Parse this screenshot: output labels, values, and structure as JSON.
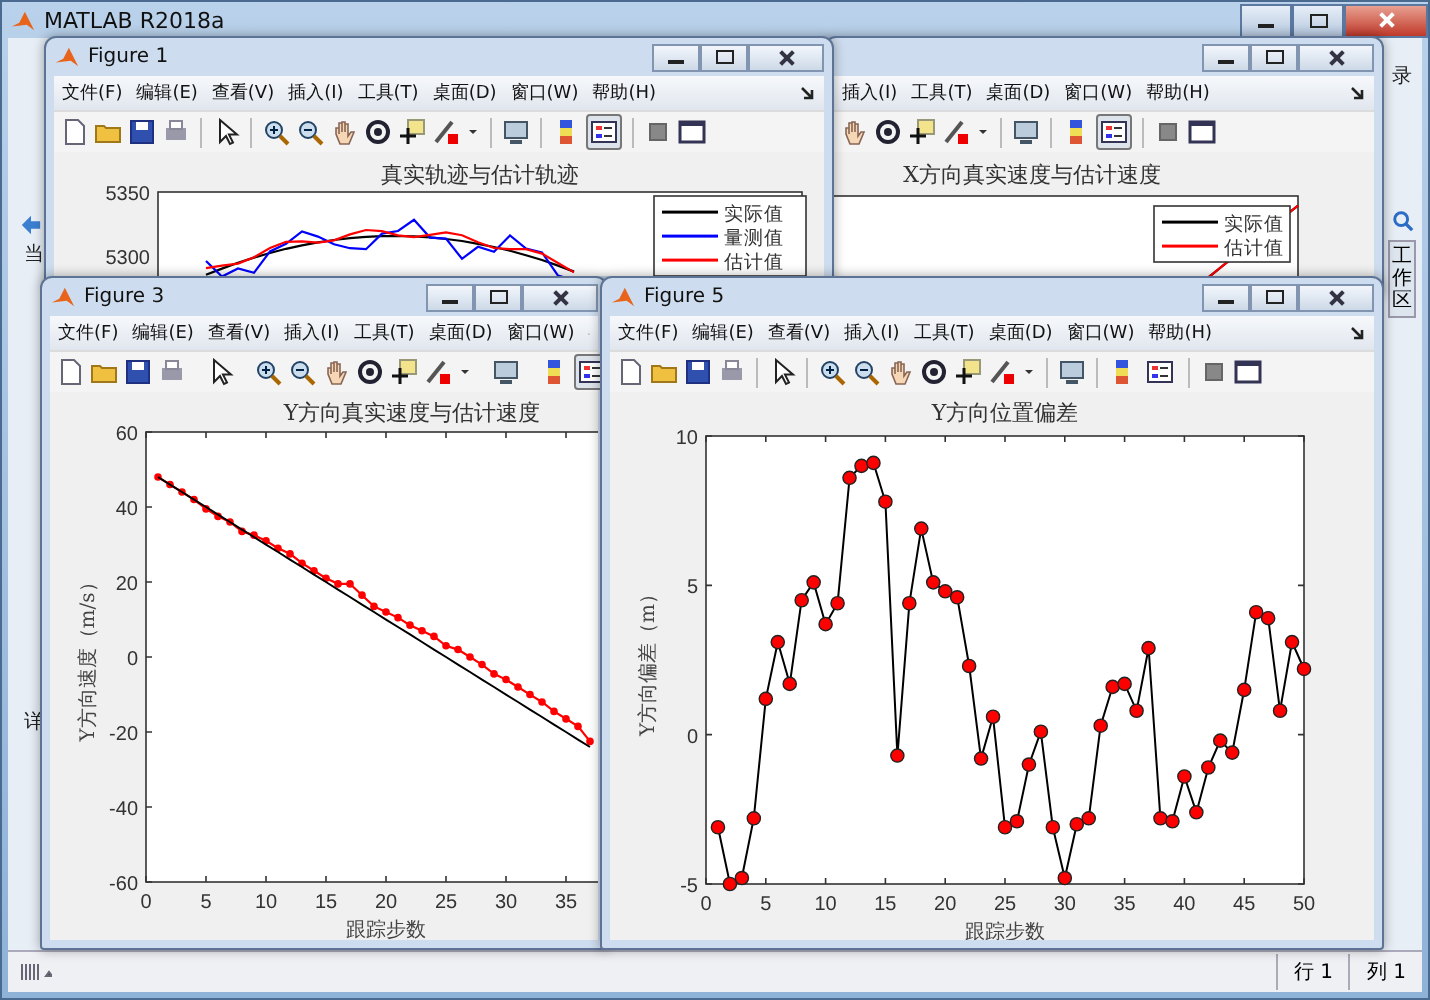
{
  "app": {
    "title": "MATLAB R2018a",
    "left_labels": [
      "当",
      "详"
    ],
    "right_label": "录",
    "workspace_tab": "工作区",
    "status_row": "行 1",
    "status_col": "列 1"
  },
  "figures": [
    {
      "title": "Figure 1",
      "kind": "legend_plot",
      "menus": [
        "文件(F)",
        "编辑(E)",
        "查看(V)",
        "插入(I)",
        "工具(T)",
        "桌面(D)",
        "窗口(W)",
        "帮助(H)"
      ],
      "legend_button_pressed": true,
      "plot": {
        "title": "真实轨迹与估计轨迹",
        "ytick_labels": [
          "5350",
          "5300"
        ],
        "legend": [
          {
            "label": "实际值",
            "color": "#000000"
          },
          {
            "label": "量测值",
            "color": "#0000ff"
          },
          {
            "label": "估计值",
            "color": "#ff0000"
          }
        ]
      }
    },
    {
      "kind": "legend_plot",
      "menus": [
        "插入(I)",
        "工具(T)",
        "桌面(D)",
        "窗口(W)",
        "帮助(H)"
      ],
      "legend_button_pressed": true,
      "plot": {
        "title": "X方向真实速度与估计速度",
        "legend": [
          {
            "label": "实际值",
            "color": "#000000"
          },
          {
            "label": "估计值",
            "color": "#ff0000"
          }
        ]
      }
    },
    {
      "title": "Figure 3",
      "kind": "chart",
      "menus": [
        "文件(F)",
        "编辑(E)",
        "查看(V)",
        "插入(I)",
        "工具(T)",
        "桌面(D)",
        "窗口(W)"
      ],
      "legend_button_pressed": true,
      "chart_data": {
        "type": "line",
        "title": "Y方向真实速度与估计速度",
        "xlabel": "跟踪步数",
        "ylabel": "Y方向速度（m/s）",
        "x": [
          1,
          2,
          3,
          4,
          5,
          6,
          7,
          8,
          9,
          10,
          11,
          12,
          13,
          14,
          15,
          16,
          17,
          18,
          19,
          20,
          21,
          22,
          23,
          24,
          25,
          26,
          27,
          28,
          29,
          30,
          31,
          32,
          33,
          34,
          35,
          36,
          37
        ],
        "xlim": [
          0,
          50
        ],
        "ylim": [
          -60,
          60
        ],
        "xticks": [
          0,
          5,
          10,
          15,
          20,
          25,
          30,
          35
        ],
        "yticks": [
          -60,
          -40,
          -20,
          0,
          20,
          40,
          60
        ],
        "series": [
          {
            "color": "#000000",
            "values": [
              48,
              46,
              44,
              42,
              40,
              38,
              36,
              34,
              32,
              30,
              28,
              26,
              24,
              22,
              20,
              18,
              16,
              14,
              12,
              10,
              8,
              6,
              4,
              2,
              0,
              -2,
              -4,
              -6,
              -8,
              -10,
              -12,
              -14,
              -16,
              -18,
              -20,
              -22,
              -24
            ]
          },
          {
            "color": "#ff0000",
            "marker": "circle",
            "values": [
              48,
              46,
              44,
              42,
              39.5,
              37.5,
              36,
              33.5,
              32.5,
              31,
              29,
              27.5,
              25,
              23,
              21,
              19.5,
              19.5,
              16.5,
              13.5,
              12,
              10.5,
              8.5,
              7,
              5.5,
              3,
              2,
              0,
              -2,
              -4.5,
              -6,
              -8,
              -10,
              -12,
              -14.5,
              -16.5,
              -18.5,
              -22.5
            ]
          }
        ]
      }
    },
    {
      "title": "Figure 5",
      "kind": "chart",
      "menus": [
        "文件(F)",
        "编辑(E)",
        "查看(V)",
        "插入(I)",
        "工具(T)",
        "桌面(D)",
        "窗口(W)",
        "帮助(H)"
      ],
      "legend_button_pressed": false,
      "chart_data": {
        "type": "line",
        "title": "Y方向位置偏差",
        "xlabel": "跟踪步数",
        "ylabel": "Y方向偏差（m）",
        "x": [
          1,
          2,
          3,
          4,
          5,
          6,
          7,
          8,
          9,
          10,
          11,
          12,
          13,
          14,
          15,
          16,
          17,
          18,
          19,
          20,
          21,
          22,
          23,
          24,
          25,
          26,
          27,
          28,
          29,
          30,
          31,
          32,
          33,
          34,
          35,
          36,
          37,
          38,
          39,
          40,
          41,
          42,
          43,
          44,
          45,
          46,
          47,
          48,
          49,
          50
        ],
        "xlim": [
          0,
          50
        ],
        "ylim": [
          -5,
          10
        ],
        "xticks": [
          0,
          5,
          10,
          15,
          20,
          25,
          30,
          35,
          40,
          45,
          50
        ],
        "yticks": [
          -5,
          0,
          5,
          10
        ],
        "series": [
          {
            "color": "#000000",
            "marker": "circle",
            "values": [
              -3.1,
              -5,
              -4.8,
              -2.8,
              1.2,
              3.1,
              1.7,
              4.5,
              5.1,
              3.7,
              4.4,
              8.6,
              9.0,
              9.1,
              7.8,
              -0.7,
              4.4,
              6.9,
              5.1,
              4.8,
              4.6,
              2.3,
              -0.8,
              0.6,
              -3.1,
              -2.9,
              -1.0,
              0.1,
              -3.1,
              -4.8,
              -3.0,
              -2.8,
              0.3,
              1.6,
              1.7,
              0.8,
              2.9,
              -2.8,
              -2.9,
              -1.4,
              -2.6,
              -1.1,
              -0.2,
              -0.6,
              1.5,
              4.1,
              3.9,
              0.8,
              3.1,
              2.2
            ]
          }
        ]
      }
    }
  ]
}
